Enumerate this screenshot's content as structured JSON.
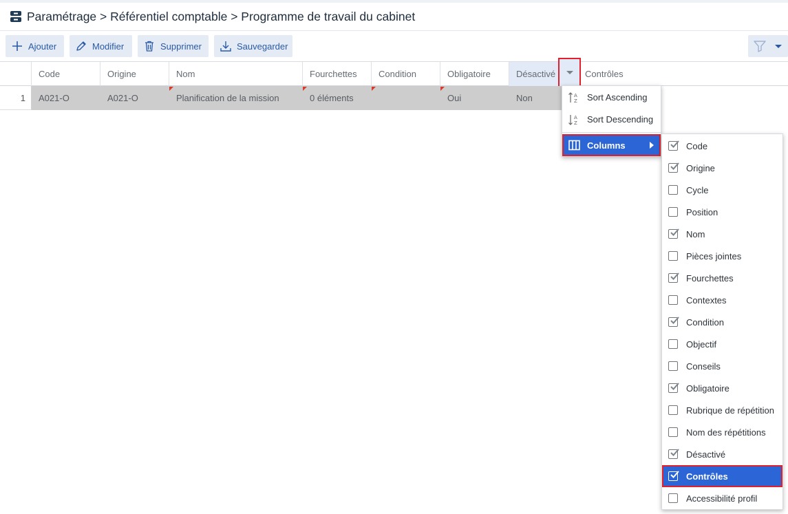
{
  "breadcrumb": "Paramétrage > Référentiel comptable > Programme de travail du cabinet",
  "toolbar": {
    "add_label": "Ajouter",
    "edit_label": "Modifier",
    "delete_label": "Supprimer",
    "save_label": "Sauvegarder"
  },
  "grid": {
    "headers": {
      "code": "Code",
      "origine": "Origine",
      "nom": "Nom",
      "fourchettes": "Fourchettes",
      "condition": "Condition",
      "obligatoire": "Obligatoire",
      "desactive": "Désactivé",
      "controles": "Contrôles"
    },
    "row": {
      "num": "1",
      "code": "A021-O",
      "origine": "A021-O",
      "nom": "Planification de la mission",
      "fourchettes": "0 éléments",
      "condition": "",
      "obligatoire": "Oui",
      "desactive": "Non"
    }
  },
  "menu": {
    "sort_asc": "Sort Ascending",
    "sort_desc": "Sort Descending",
    "columns": "Columns"
  },
  "columns_menu": [
    {
      "label": "Code",
      "checked": true
    },
    {
      "label": "Origine",
      "checked": true
    },
    {
      "label": "Cycle",
      "checked": false
    },
    {
      "label": "Position",
      "checked": false
    },
    {
      "label": "Nom",
      "checked": true
    },
    {
      "label": "Pièces jointes",
      "checked": false
    },
    {
      "label": "Fourchettes",
      "checked": true
    },
    {
      "label": "Contextes",
      "checked": false
    },
    {
      "label": "Condition",
      "checked": true
    },
    {
      "label": "Objectif",
      "checked": false
    },
    {
      "label": "Conseils",
      "checked": false
    },
    {
      "label": "Obligatoire",
      "checked": true
    },
    {
      "label": "Rubrique de répétition",
      "checked": false
    },
    {
      "label": "Nom des répétitions",
      "checked": false
    },
    {
      "label": "Désactivé",
      "checked": true
    },
    {
      "label": "Contrôles",
      "checked": true,
      "highlighted": true
    },
    {
      "label": "Accessibilité profil",
      "checked": false
    }
  ],
  "colors": {
    "accent": "#2c65d6",
    "highlight_border": "#e0202c",
    "toolbar_button_bg": "#e4ebf5",
    "selected_row_bg": "#cdcdcd"
  }
}
